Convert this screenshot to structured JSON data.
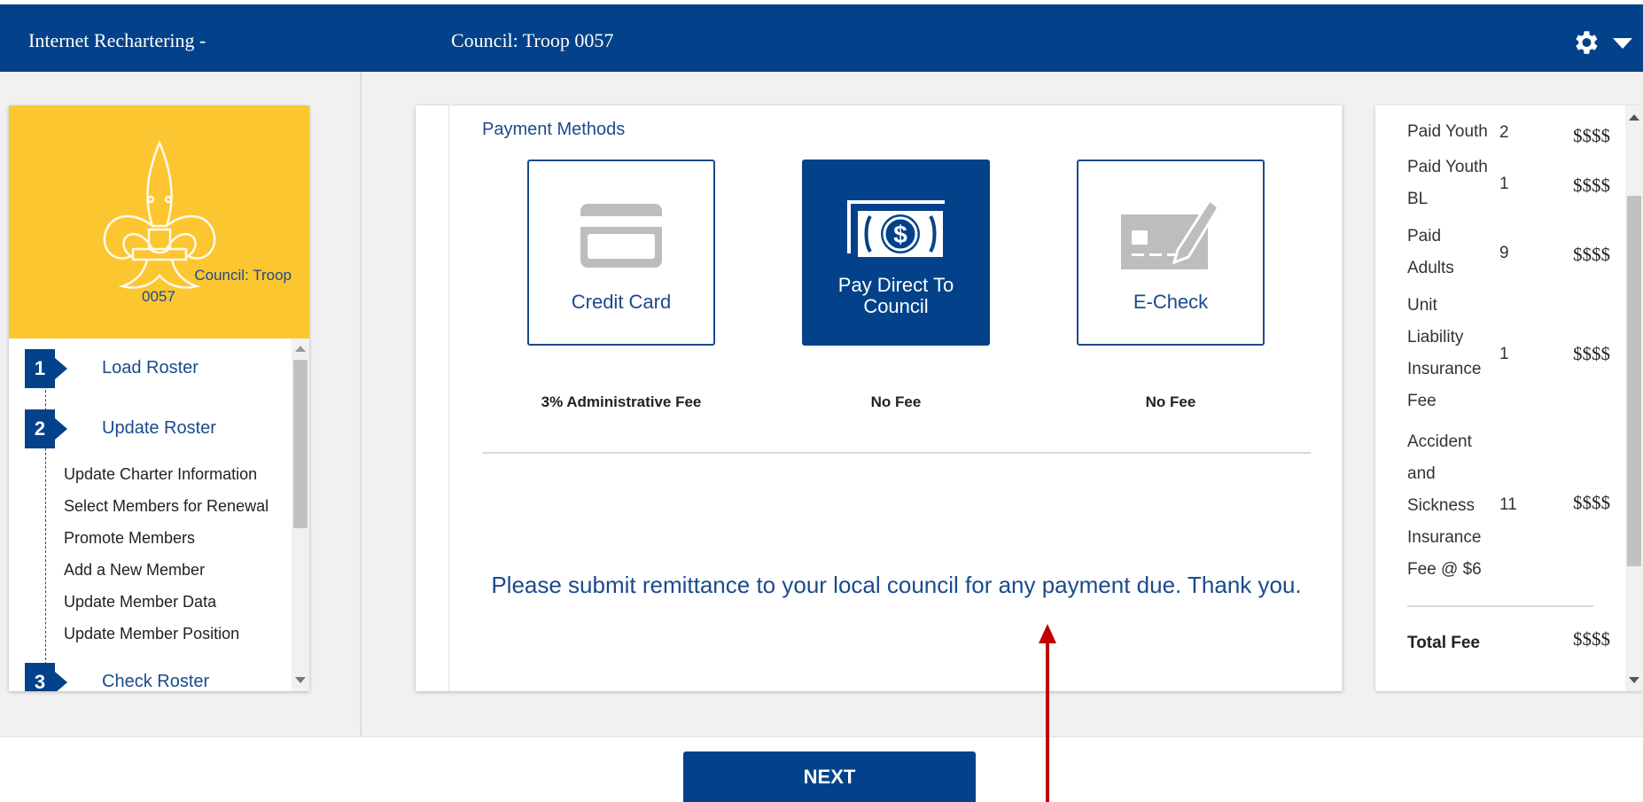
{
  "header": {
    "app_title": "Internet Rechartering -",
    "council": "Council: Troop 0057"
  },
  "sidebar": {
    "council_line1": "Council: Troop",
    "council_line2": "0057",
    "steps": [
      {
        "number": "1",
        "label": "Load Roster"
      },
      {
        "number": "2",
        "label": "Update Roster"
      },
      {
        "number": "3",
        "label": "Check Roster"
      }
    ],
    "subitems": [
      "Update Charter Information",
      "Select Members for Renewal",
      "Promote Members",
      "Add a New Member",
      "Update Member Data",
      "Update Member Position"
    ]
  },
  "payment": {
    "title": "Payment Methods",
    "options": [
      {
        "label": "Credit Card",
        "fee": "3% Administrative Fee",
        "selected": false
      },
      {
        "label_line1": "Pay Direct To",
        "label_line2": "Council",
        "fee": "No Fee",
        "selected": true
      },
      {
        "label": "E-Check",
        "fee": "No Fee",
        "selected": false
      }
    ],
    "message": "Please submit remittance to your local council for any payment due. Thank you."
  },
  "fees": {
    "rows": [
      {
        "name": "Paid Youth",
        "count": "2",
        "amount": "$$$$"
      },
      {
        "name": "Paid Youth BL",
        "count": "1",
        "amount": "$$$$"
      },
      {
        "name": "Paid Adults",
        "count": "9",
        "amount": "$$$$"
      },
      {
        "name": "Unit Liability Insurance Fee",
        "count": "1",
        "amount": "$$$$"
      },
      {
        "name": "Accident and Sickness Insurance Fee @ $6",
        "count": "11",
        "amount": "$$$$"
      }
    ],
    "total_label": "Total Fee",
    "total_amount": "$$$$"
  },
  "footer": {
    "next_label": "NEXT"
  },
  "colors": {
    "brand_blue": "#03428a",
    "gold": "#fcc631",
    "link_blue": "#1b4a8c",
    "annotation_red": "#c00000"
  },
  "icons": [
    "gear-icon",
    "chevron-down-icon",
    "fleur-de-lis-logo",
    "credit-card-icon",
    "cash-icon",
    "check-icon",
    "red-arrow-annotation"
  ]
}
